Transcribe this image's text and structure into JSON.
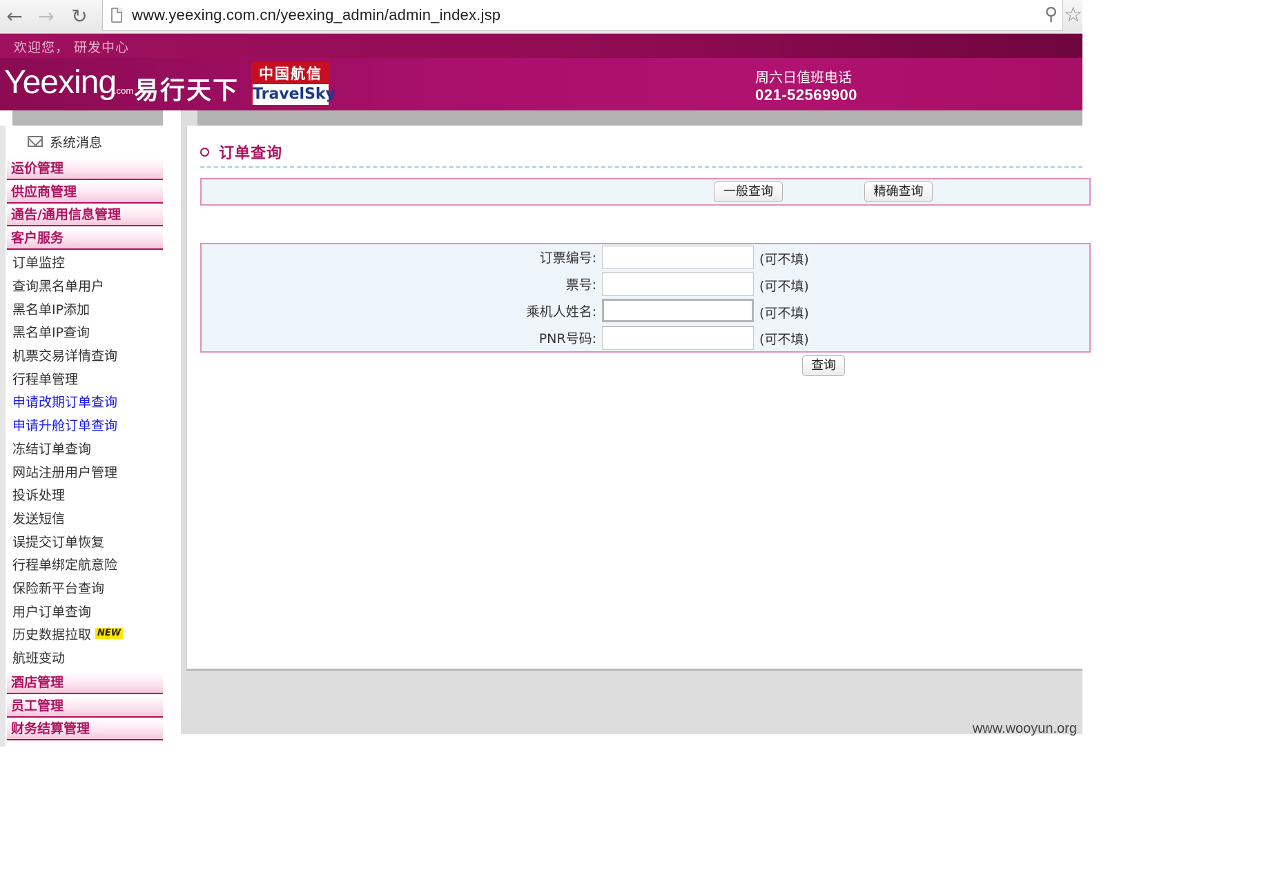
{
  "browser": {
    "url": "www.yeexing.com.cn/yeexing_admin/admin_index.jsp",
    "icons": [
      "back-arrow-icon",
      "forward-arrow-icon",
      "reload-icon",
      "page-icon",
      "key-icon",
      "star-icon"
    ]
  },
  "header": {
    "welcome": "欢迎您，  研发中心",
    "logo_main": "Yeexing",
    "logo_com": ".com",
    "logo_cn": "易行天下",
    "travelsky_cn": "中国航信",
    "travelsky_en": "TravelSky",
    "duty_label": "周六日值班电话",
    "duty_phone": "021-52569900"
  },
  "sidebar": {
    "system_message": "系统消息",
    "categories_top": [
      "运价管理",
      "供应商管理",
      "通告/通用信息管理",
      "客户服务"
    ],
    "items": [
      "订单监控",
      "查询黑名单用户",
      "黑名单IP添加",
      "黑名单IP查询",
      "机票交易详情查询",
      "行程单管理",
      "申请改期订单查询",
      "申请升舱订单查询",
      "冻结订单查询",
      "网站注册用户管理",
      "投诉处理",
      "发送短信",
      "误提交订单恢复",
      "行程单绑定航意险",
      "保险新平台查询",
      "用户订单查询",
      "历史数据拉取",
      "航班变动"
    ],
    "new_badge": "NEW",
    "categories_bottom": [
      "酒店管理",
      "员工管理",
      "财务结算管理"
    ],
    "colors": {
      "category": "#b0125f",
      "link_blue": "#1a1ae6"
    }
  },
  "main": {
    "title": "订单查询",
    "tab_general": "一般查询",
    "tab_exact": "精确查询",
    "fields": [
      {
        "label": "订票编号:",
        "value": "",
        "hint": "(可不填)"
      },
      {
        "label": "票号:",
        "value": "",
        "hint": "(可不填)"
      },
      {
        "label": "乘机人姓名:",
        "value": "",
        "hint": "(可不填)"
      },
      {
        "label": "PNR号码:",
        "value": "",
        "hint": "(可不填)"
      }
    ],
    "submit": "查询"
  },
  "watermark": "www.wooyun.org"
}
